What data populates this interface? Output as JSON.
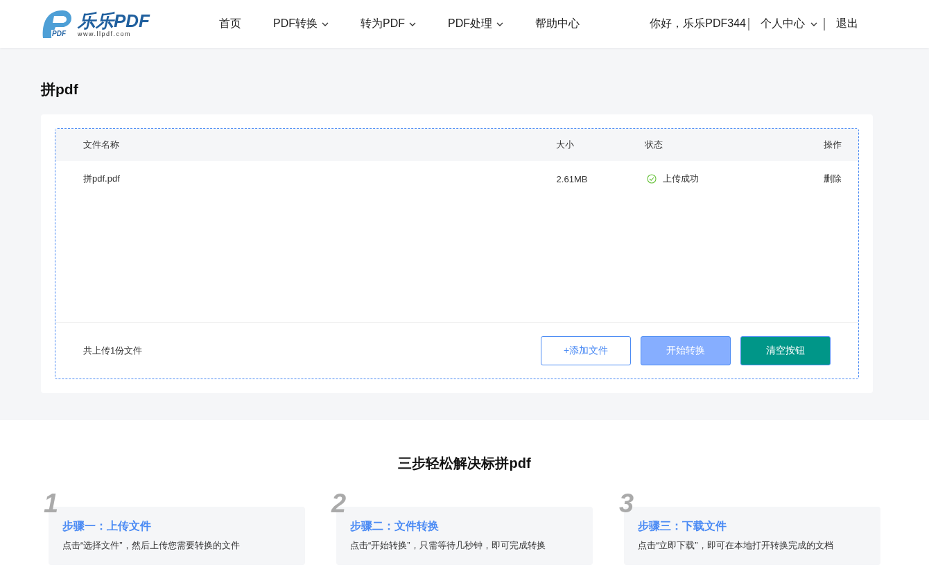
{
  "logo": {
    "mark": "PDF",
    "name": "乐乐PDF",
    "url": "www.llpdf.com"
  },
  "nav": [
    {
      "label": "首页",
      "dropdown": false
    },
    {
      "label": "PDF转换",
      "dropdown": true
    },
    {
      "label": "转为PDF",
      "dropdown": true
    },
    {
      "label": "PDF处理",
      "dropdown": true
    },
    {
      "label": "帮助中心",
      "dropdown": false
    }
  ],
  "user": {
    "greeting": "你好，乐乐PDF344",
    "center": "个人中心",
    "logout": "退出"
  },
  "page_title": "拼pdf",
  "table": {
    "columns": [
      "文件名称",
      "大小",
      "状态",
      "操作"
    ],
    "rows": [
      {
        "name": "拼pdf.pdf",
        "size": "2.61MB",
        "status": "上传成功",
        "action": "删除"
      }
    ]
  },
  "summary": "共上传1份文件",
  "buttons": [
    {
      "label": "+添加文件",
      "kind": "outline"
    },
    {
      "label": "开始转换",
      "kind": "light"
    },
    {
      "label": "清空按钮",
      "kind": "teal"
    }
  ],
  "steps_title": "三步轻松解决标拼pdf",
  "steps": [
    {
      "number": "1",
      "title": "步骤一：上传文件",
      "text": "点击“选择文件”，然后上传您需要转换的文件"
    },
    {
      "number": "2",
      "title": "步骤二：文件转换",
      "text": "点击“开始转换”，只需等待几秒钟，即可完成转换"
    },
    {
      "number": "3",
      "title": "步骤三：下载文件",
      "text": "点击“立即下载”，即可在本地打开转换完成的文档"
    }
  ]
}
